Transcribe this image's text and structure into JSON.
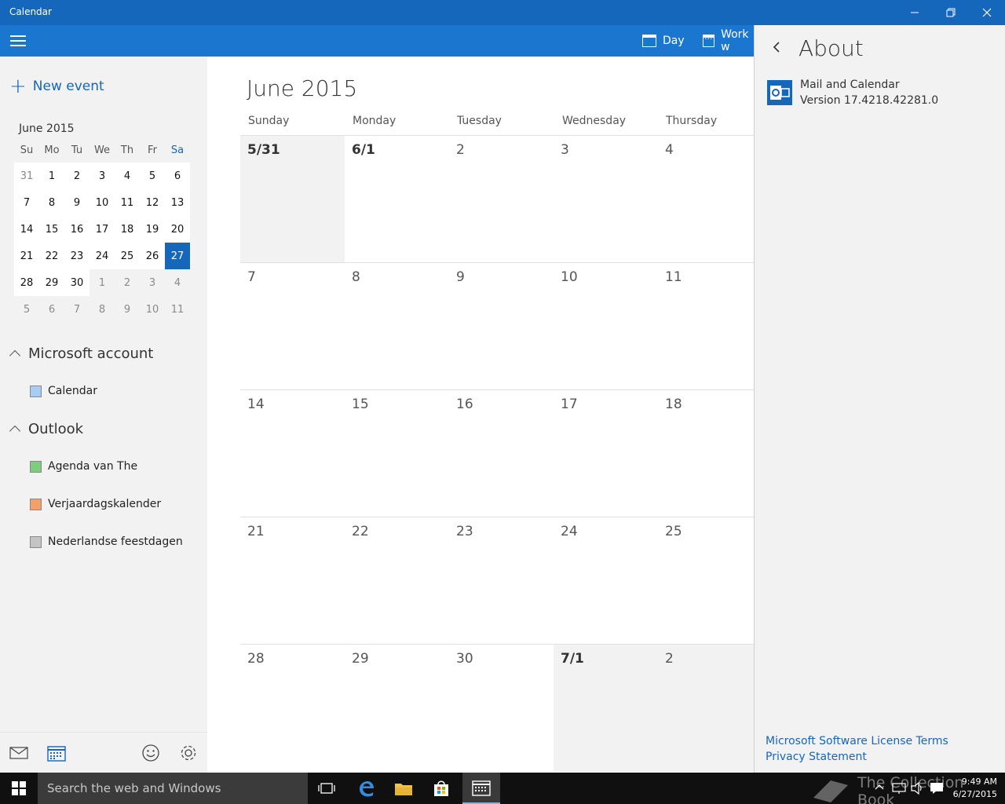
{
  "window": {
    "title": "Calendar"
  },
  "toolbar": {
    "day_label": "Day",
    "workweek_label": "Work w"
  },
  "sidebar": {
    "new_event": "New event",
    "mini_calendar": {
      "month_label": "June 2015",
      "weekdays": [
        "Su",
        "Mo",
        "Tu",
        "We",
        "Th",
        "Fr",
        "Sa"
      ],
      "weeks": [
        [
          "31",
          "1",
          "2",
          "3",
          "4",
          "5",
          "6"
        ],
        [
          "7",
          "8",
          "9",
          "10",
          "11",
          "12",
          "13"
        ],
        [
          "14",
          "15",
          "16",
          "17",
          "18",
          "19",
          "20"
        ],
        [
          "21",
          "22",
          "23",
          "24",
          "25",
          "26",
          "27"
        ],
        [
          "28",
          "29",
          "30",
          "1",
          "2",
          "3",
          "4"
        ],
        [
          "5",
          "6",
          "7",
          "8",
          "9",
          "10",
          "11"
        ]
      ],
      "selected": "27"
    },
    "accounts": [
      {
        "name": "Microsoft account",
        "calendars": [
          {
            "name": "Calendar",
            "color": "#a6cdf2"
          }
        ]
      },
      {
        "name": "Outlook",
        "calendars": [
          {
            "name": "Agenda van The",
            "color": "#7fcc7f"
          },
          {
            "name": "Verjaardagskalender",
            "color": "#f3a06a"
          },
          {
            "name": "Nederlandse feestdagen",
            "color": "#c4c4c4"
          }
        ]
      }
    ]
  },
  "calendar": {
    "month_title": "June 2015",
    "day_headers": [
      "Sunday",
      "Monday",
      "Tuesday",
      "Wednesday",
      "Thursday"
    ],
    "weeks": [
      [
        "5/31",
        "6/1",
        "2",
        "3",
        "4"
      ],
      [
        "7",
        "8",
        "9",
        "10",
        "11"
      ],
      [
        "14",
        "15",
        "16",
        "17",
        "18"
      ],
      [
        "21",
        "22",
        "23",
        "24",
        "25"
      ],
      [
        "28",
        "29",
        "30",
        "7/1",
        "2"
      ]
    ]
  },
  "about": {
    "heading": "About",
    "app_name": "Mail and Calendar",
    "version": "Version 17.4218.42281.0",
    "license_link": "Microsoft Software License Terms",
    "privacy_link": "Privacy Statement"
  },
  "taskbar": {
    "search_placeholder": "Search the web and Windows",
    "watermark": "The Collection Book",
    "time": "9:49 AM",
    "date": "6/27/2015"
  },
  "colors": {
    "titlebar": "#1467ba",
    "toolbar": "#1b76d0",
    "accent": "#1467ba"
  }
}
